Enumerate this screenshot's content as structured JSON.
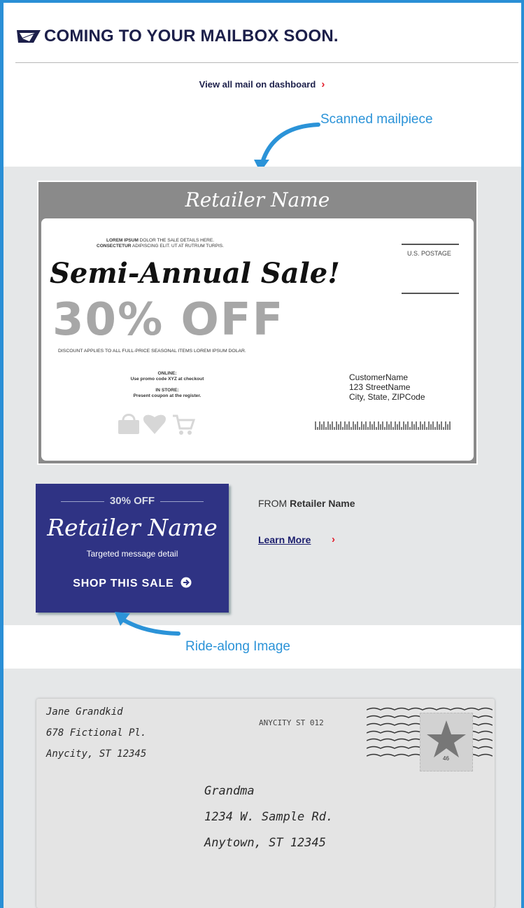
{
  "header": {
    "title": "COMING TO YOUR MAILBOX SOON."
  },
  "dashboard_link": {
    "label": "View all mail on dashboard",
    "chevron": "›"
  },
  "annotations": {
    "scanned": "Scanned mailpiece",
    "ride_along": "Ride-along Image"
  },
  "mailpiece": {
    "header_name": "Retailer Name",
    "lorem_line1_bold": "LOREM IPSUM",
    "lorem_line1": " DOLOR THE SALE DETAILS HERE.",
    "lorem_line2_bold": "CONSECTETUR",
    "lorem_line2": " ADIPISCING ELIT. UT AT RUTRUM TURPIS.",
    "sale_title": "Semi-Annual Sale!",
    "discount_big": "30% OFF",
    "discount_note": "DISCOUNT APPLIES TO ALL FULL-PRICE SEASONAL ITEMS LOREM IPSUM DOLAR.",
    "online_label": "ONLINE:",
    "online_text": "Use promo code XYZ at checkout",
    "instore_label": "IN STORE:",
    "instore_text": "Present coupon at the register.",
    "postage": "U.S. POSTAGE",
    "address": [
      "CustomerName",
      "123 StreetName",
      "City, State, ZIPCode"
    ],
    "icons": [
      "shopping-bag-icon",
      "heart-icon",
      "cart-icon"
    ]
  },
  "ride_along": {
    "offer": "30% OFF",
    "name": "Retailer Name",
    "detail": "Targeted message detail",
    "cta": "SHOP THIS SALE",
    "cta_icon": "arrow-circle-right-icon"
  },
  "info": {
    "from_prefix": "FROM",
    "from_name": "Retailer Name",
    "learn_more": "Learn More",
    "chevron": "›"
  },
  "envelope": {
    "return_address": [
      "Jane Grandkid",
      "678 Fictional Pl.",
      "Anycity, ST 12345"
    ],
    "postmark": "ANYCITY ST 012",
    "stamp_value": "46",
    "recipient_address": [
      "Grandma",
      "1234 W. Sample Rd.",
      "Anytown, ST 12345"
    ]
  },
  "colors": {
    "accent_blue": "#2a8fd6",
    "navy": "#1c1f4a",
    "red": "#e31b2a",
    "ride_bg": "#2f3384"
  }
}
